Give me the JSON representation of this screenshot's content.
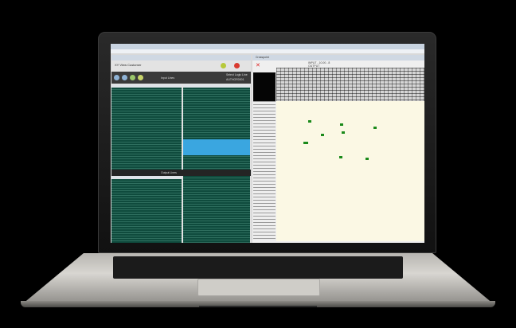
{
  "screen": {
    "left_window_title": "XY View Customer",
    "input_label": "Input Lines",
    "output_label": "Output Lines",
    "select_logic_label": "Select Logic Line",
    "logic_line_value": "AUTHOR0001",
    "right_window_title": "Crosspoint",
    "right_header_text": "INPUT - 10.00 - 8",
    "right_header_sub": "OUTPUT"
  },
  "colors": {
    "grid_green": "#0f4b3d",
    "selection_cyan": "#3aa6e0",
    "matrix_bg": "#fbf8e4",
    "dot_green": "#1a8a1a"
  }
}
